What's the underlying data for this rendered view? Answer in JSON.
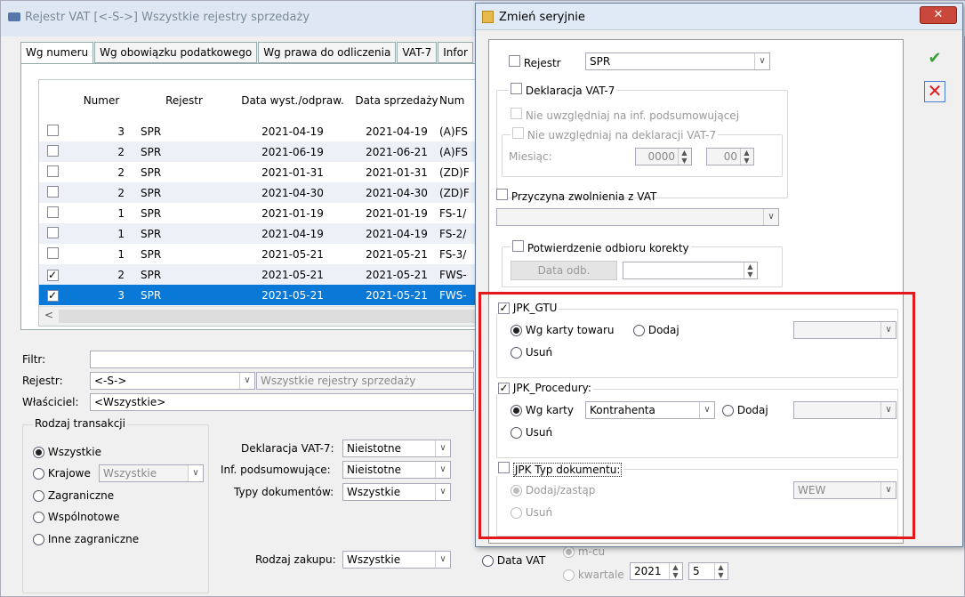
{
  "bg": {
    "title": "Rejestr VAT  [<-S->]  Wszystkie rejestry sprzedaży",
    "tabs": [
      "Wg numeru",
      "Wg obowiązku podatkowego",
      "Wg prawa do odliczenia",
      "VAT-7",
      "Infor"
    ],
    "grid": {
      "headers": [
        "Numer",
        "Rejestr",
        "Data wyst./odpraw.",
        "Data sprzedaży",
        "Num"
      ],
      "rows": [
        {
          "checked": false,
          "num": "3",
          "rej": "SPR",
          "d1": "2021-04-19",
          "d2": "2021-04-19",
          "n": "(A)FS"
        },
        {
          "checked": false,
          "num": "2",
          "rej": "SPR",
          "d1": "2021-06-19",
          "d2": "2021-06-21",
          "n": "(A)FS"
        },
        {
          "checked": false,
          "num": "2",
          "rej": "SPR",
          "d1": "2021-01-31",
          "d2": "2021-01-31",
          "n": "(ZD)F"
        },
        {
          "checked": false,
          "num": "2",
          "rej": "SPR",
          "d1": "2021-04-30",
          "d2": "2021-04-30",
          "n": "(ZD)F"
        },
        {
          "checked": false,
          "num": "1",
          "rej": "SPR",
          "d1": "2021-01-19",
          "d2": "2021-01-19",
          "n": "FS-1/"
        },
        {
          "checked": false,
          "num": "1",
          "rej": "SPR",
          "d1": "2021-04-19",
          "d2": "2021-04-19",
          "n": "FS-2/"
        },
        {
          "checked": false,
          "num": "1",
          "rej": "SPR",
          "d1": "2021-05-21",
          "d2": "2021-05-21",
          "n": "FS-3/"
        },
        {
          "checked": true,
          "num": "2",
          "rej": "SPR",
          "d1": "2021-05-21",
          "d2": "2021-05-21",
          "n": "FWS-"
        },
        {
          "checked": true,
          "num": "3",
          "rej": "SPR",
          "d1": "2021-05-21",
          "d2": "2021-05-21",
          "n": "FWS-"
        }
      ]
    },
    "filter_label": "Filtr:",
    "rejestr_label": "Rejestr:",
    "rejestr_value": "<-S->",
    "rejestr_desc": "Wszystkie rejestry sprzedaży",
    "owner_label": "Właściciel:",
    "owner_value": "<Wszystkie>",
    "transaction_group": "Rodzaj transakcji",
    "transactions": [
      "Wszystkie",
      "Krajowe",
      "Zagraniczne",
      "Wspólnotowe",
      "Inne zagraniczne"
    ],
    "krajowe_value": "Wszystkie",
    "decl_label": "Deklaracja VAT-7:",
    "decl_value": "Nieistotne",
    "inf_label": "Inf. podsumowujące:",
    "inf_value": "Nieistotne",
    "types_label": "Typy dokumentów:",
    "types_value": "Wszystkie",
    "purchase_label": "Rodzaj zakupu:",
    "purchase_value": "Wszystkie",
    "datavat_label": "Data VAT",
    "mcu_label": "m-cu",
    "kwartale_label": "kwartale",
    "year": "2021",
    "month": "5"
  },
  "dialog": {
    "title": "Zmień seryjnie",
    "rejestr_label": "Rejestr",
    "rejestr_value": "SPR",
    "decl_label": "Deklaracja VAT-7",
    "ignore_inf": "Nie uwzględniaj na inf. podsumowującej",
    "ignore_decl": "Nie uwzględniaj na deklaracji VAT-7",
    "month_label": "Miesiąc:",
    "month_year": "0000",
    "month_value": "00",
    "exempt_label": "Przyczyna zwolnienia z VAT",
    "confirm_label": "Potwierdzenie odbioru korekty",
    "date_button": "Data odb.",
    "gtu_label": "JPK_GTU",
    "gtu_opt1": "Wg karty towaru",
    "gtu_opt2": "Dodaj",
    "gtu_opt3": "Usuń",
    "proc_label": "JPK_Procedury:",
    "proc_opt1": "Wg karty",
    "proc_kontrahent": "Kontrahenta",
    "proc_opt2": "Dodaj",
    "proc_opt3": "Usuń",
    "typ_label": "JPK Typ dokumentu:",
    "typ_opt1": "Dodaj/zastąp",
    "typ_value": "WEW",
    "typ_opt2": "Usuń"
  },
  "colors": {
    "highlight": "#e1191d",
    "selection": "#0a78d7"
  }
}
